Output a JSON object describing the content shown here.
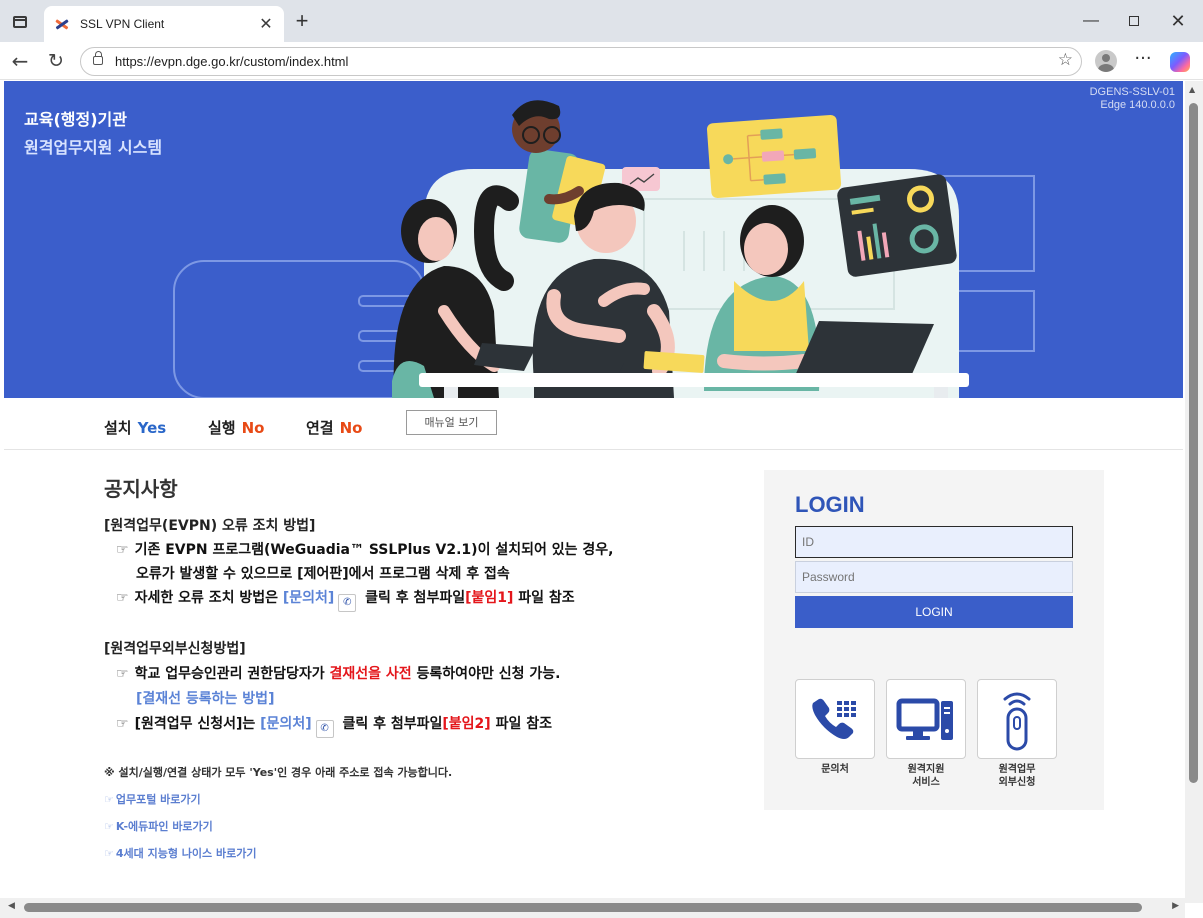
{
  "browser": {
    "tab_title": "SSL VPN Client",
    "tab_close": "✕",
    "new_tab": "+",
    "url": "https://evpn.dge.go.kr/custom/index.html",
    "window_min": "—",
    "window_close": "✕",
    "more": "···"
  },
  "banner": {
    "title_line1": "교육(행정)기관",
    "title_line2": "원격업무지원 시스템",
    "device": "DGENS-SSLV-01",
    "browser_version": "Edge 140.0.0.0",
    "bg_color": "#3b5ecb"
  },
  "status": {
    "install_label": "설치",
    "install_value": "Yes",
    "run_label": "실행",
    "run_value": "No",
    "connect_label": "연결",
    "connect_value": "No",
    "manual_button": "매뉴얼 보기"
  },
  "notice": {
    "title": "공지사항",
    "section1_head": "[원격업무(EVPN) 오류 조치 방법]",
    "s1_line1": "기존 EVPN 프로그램(WeGuadia™ SSLPlus V2.1)이 설치되어 있는 경우,",
    "s1_line2": "오류가 발생할 수 있으므로 [제어판]에서 프로그램 삭제 후 접속",
    "s1_line3_pre": "자세한 오류 조치 방법은 ",
    "s1_line3_link": "[문의처]",
    "s1_line3_mid": " 클릭 후 첨부파일",
    "s1_line3_red": "[붙임1]",
    "s1_line3_post": " 파일 참조",
    "section2_head": "[원격업무외부신청방법]",
    "s2_line1_pre": "학교 업무승인관리 권한담당자가 ",
    "s2_line1_red": "결재선을 사전",
    "s2_line1_post": " 등록하여야만 신청 가능.",
    "s2_line2_link": "[결재선 등록하는 방법]",
    "s2_line3_pre": "[원격업무 신청서]는 ",
    "s2_line3_link": "[문의처]",
    "s2_line3_mid": " 클릭 후 첨부파일",
    "s2_line3_red": "[붙임2]",
    "s2_line3_post": " 파일 참조",
    "small_note": "※ 설치/실행/연결 상태가 모두 'Yes'인 경우 아래 주소로 접속 가능합니다.",
    "links": [
      "업무포털 바로가기",
      "K-에듀파인 바로가기",
      "4세대 지능형 나이스 바로가기"
    ],
    "hand_glyph": "☞"
  },
  "login": {
    "title": "LOGIN",
    "id_placeholder": "ID",
    "password_placeholder": "Password",
    "button": "LOGIN",
    "services": [
      {
        "line1": "문의처",
        "line2": ""
      },
      {
        "line1": "원격지원",
        "line2": "서비스"
      },
      {
        "line1": "원격업무",
        "line2": "외부신청"
      }
    ]
  }
}
